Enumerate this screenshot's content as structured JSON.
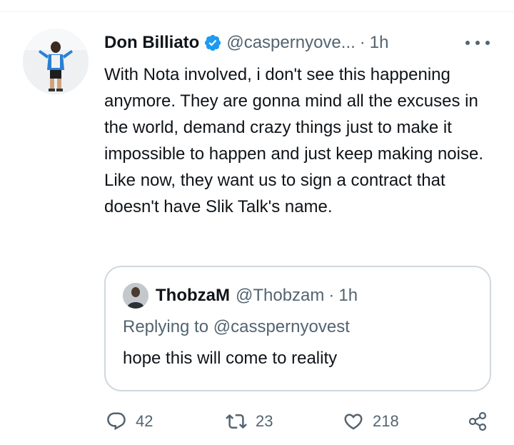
{
  "tweet": {
    "author_name": "Don Billiato",
    "handle": "@caspernyove...",
    "separator": "·",
    "time": "1h",
    "text": "With Nota involved, i don't see this happening anymore. They are gonna mind all the excuses in the world, demand crazy things just to make it impossible to happen and just keep making noise. Like now, they want us to sign a contract that doesn't have Slik Talk's name.",
    "verified": true
  },
  "quoted": {
    "author_name": "ThobzaM",
    "handle": "@Thobzam",
    "separator": "·",
    "time": "1h",
    "replying_prefix": "Replying to",
    "replying_to": "@casspernyovest",
    "text": "hope this will come to reality"
  },
  "actions": {
    "reply_count": "42",
    "retweet_count": "23",
    "like_count": "218"
  },
  "icons": {
    "verified": "verified-badge-icon",
    "more": "more-options-icon",
    "reply": "reply-icon",
    "retweet": "retweet-icon",
    "like": "heart-icon",
    "share": "share-icon"
  },
  "colors": {
    "verified_blue": "#1d9bf0",
    "text_primary": "#0f1419",
    "text_secondary": "#536471",
    "border": "#cfd9de"
  }
}
